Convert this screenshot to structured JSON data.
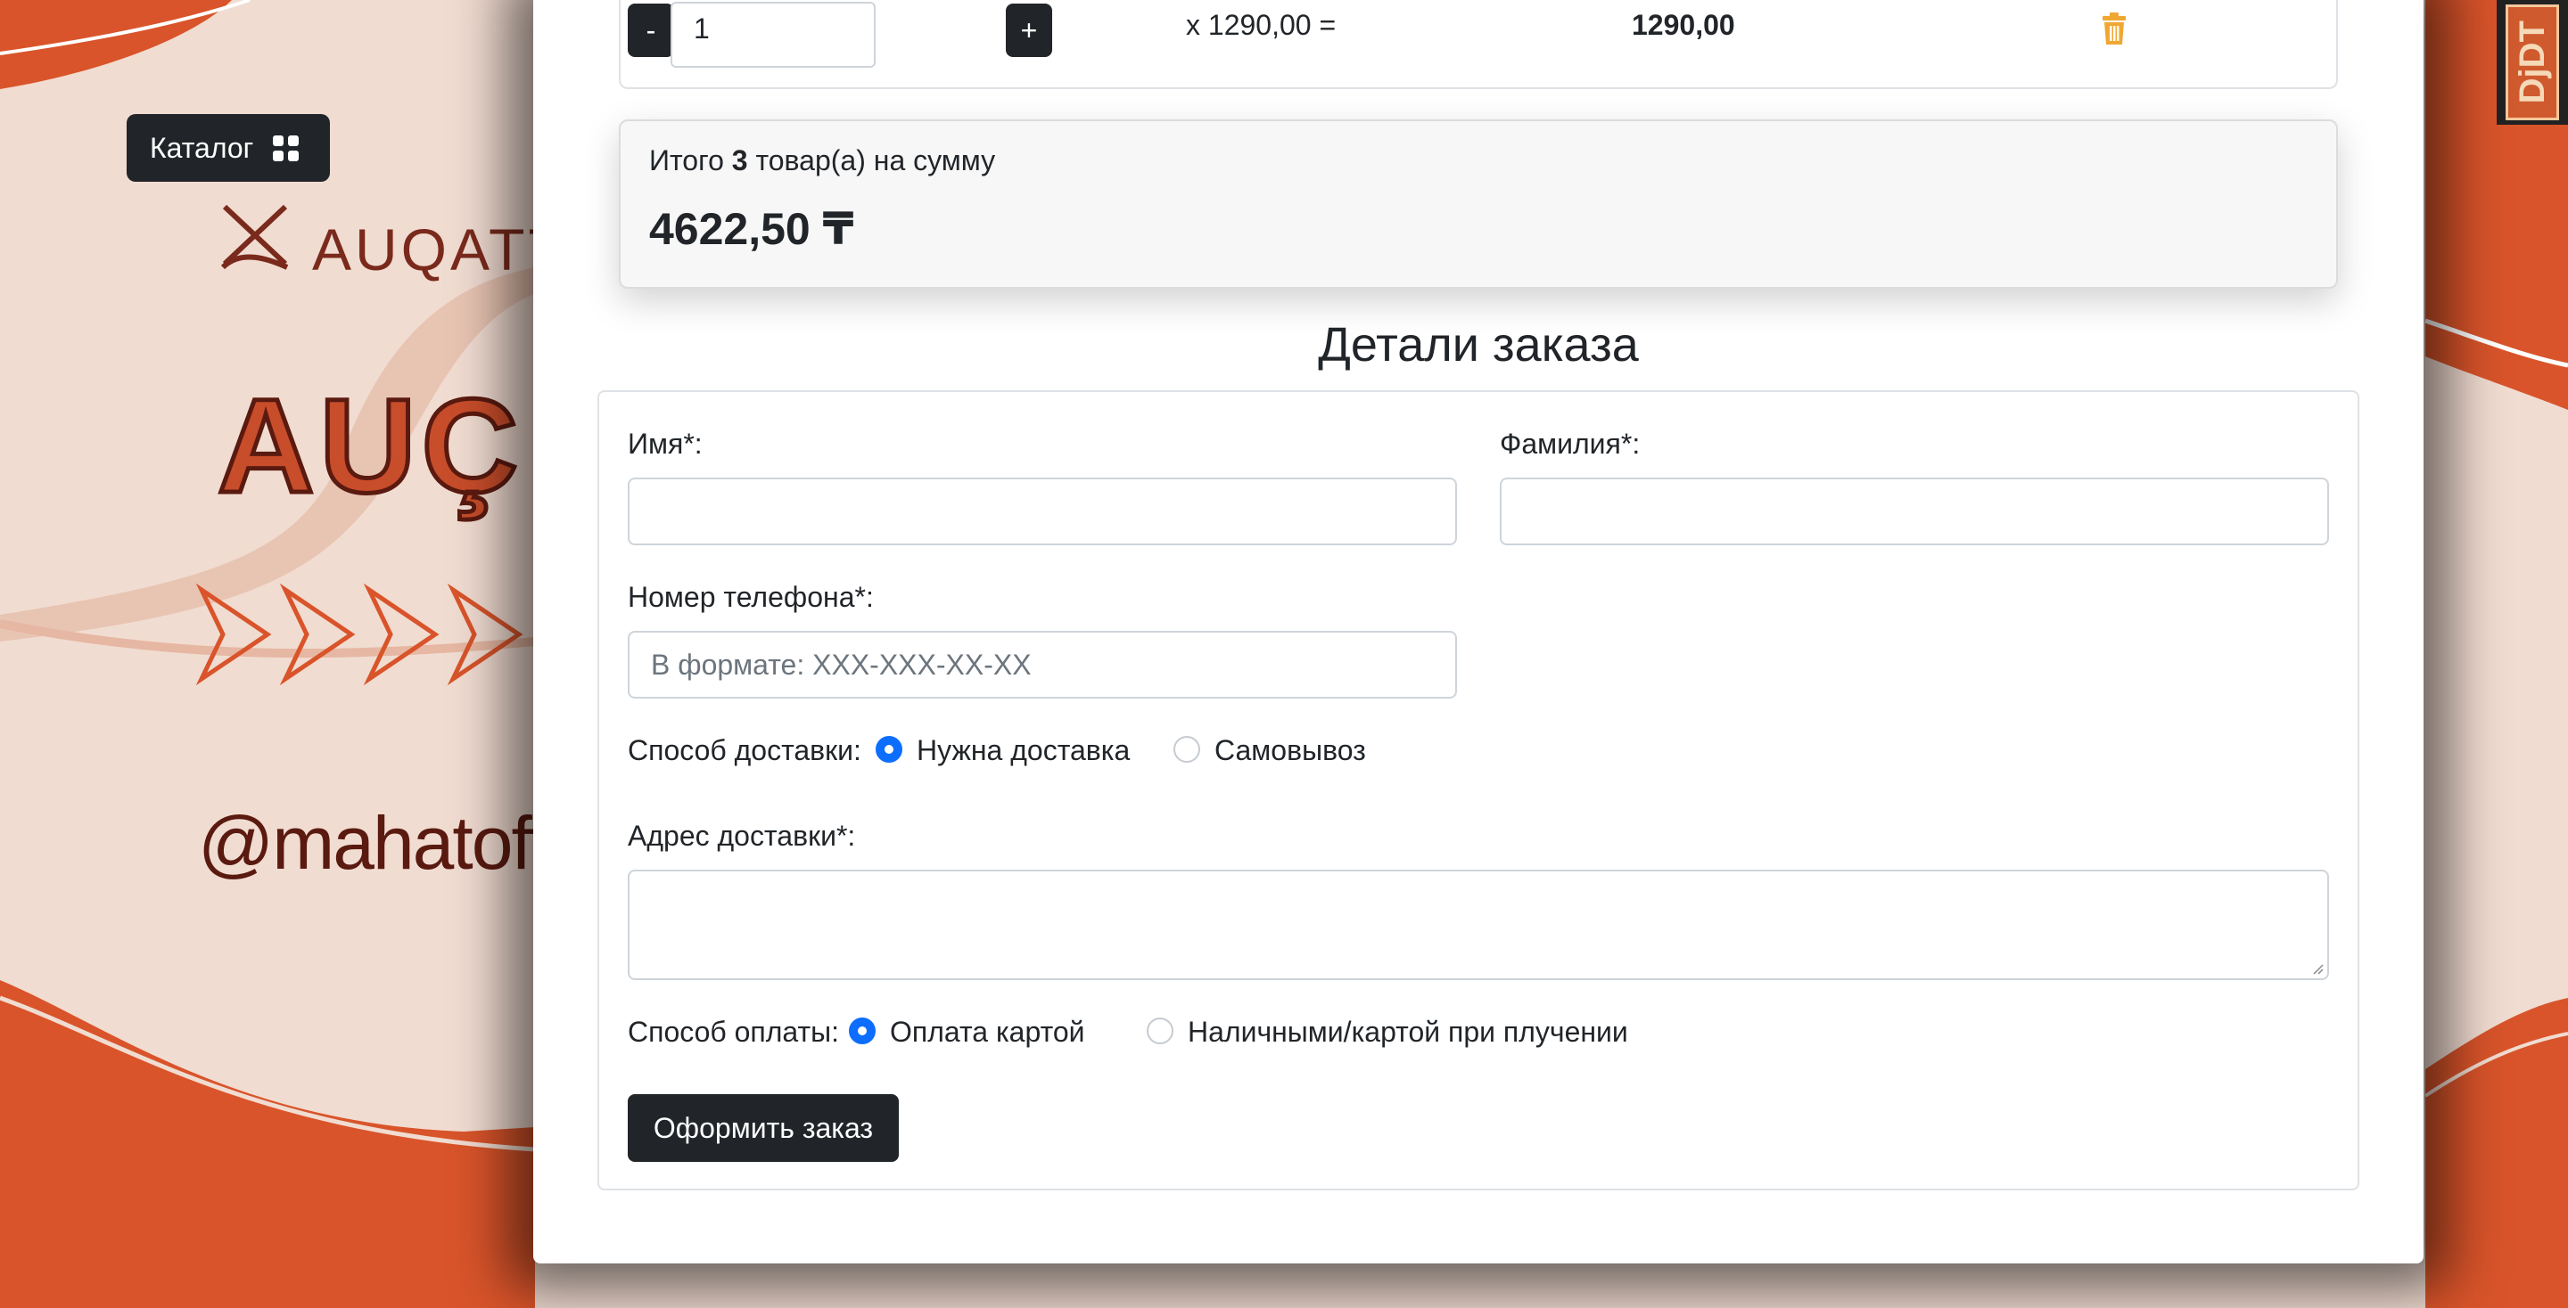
{
  "background": {
    "catalog_button": {
      "label": "Каталог",
      "icon": "grid-icon"
    },
    "brand_name": "AUQATT",
    "brand_big": "AUÇ",
    "handle": "@mahatoff",
    "debug_toolbar_label": "DjDT"
  },
  "cart": {
    "qty_minus": "-",
    "qty_value": "1",
    "qty_plus": "+",
    "unit_price_text": "x 1290,00 =",
    "line_total": "1290,00",
    "delete_icon": "trash-icon"
  },
  "summary": {
    "prefix": "Итого",
    "count": "3",
    "suffix": "товар(а) на сумму",
    "total": "4622,50 ₸"
  },
  "order_form": {
    "title": "Детали заказа",
    "first_name_label": "Имя*:",
    "first_name_value": "",
    "last_name_label": "Фамилия*:",
    "last_name_value": "",
    "phone_label": "Номер телефона*:",
    "phone_placeholder": "В формате: XXX-XXX-XX-XX",
    "delivery_label": "Способ доставки:",
    "delivery_options": [
      {
        "label": "Нужна доставка",
        "checked": true
      },
      {
        "label": "Самовывоз",
        "checked": false
      }
    ],
    "address_label": "Адрес доставки*:",
    "address_value": "",
    "payment_label": "Способ оплаты:",
    "payment_options": [
      {
        "label": "Оплата картой",
        "checked": true
      },
      {
        "label": "Наличными/картой при плучении",
        "checked": false
      }
    ],
    "submit_label": "Оформить заказ"
  },
  "colors": {
    "accent_orange": "#d9542a",
    "dark_button": "#212529",
    "radio_blue": "#0d6efd",
    "trash_icon": "#f0a732"
  }
}
